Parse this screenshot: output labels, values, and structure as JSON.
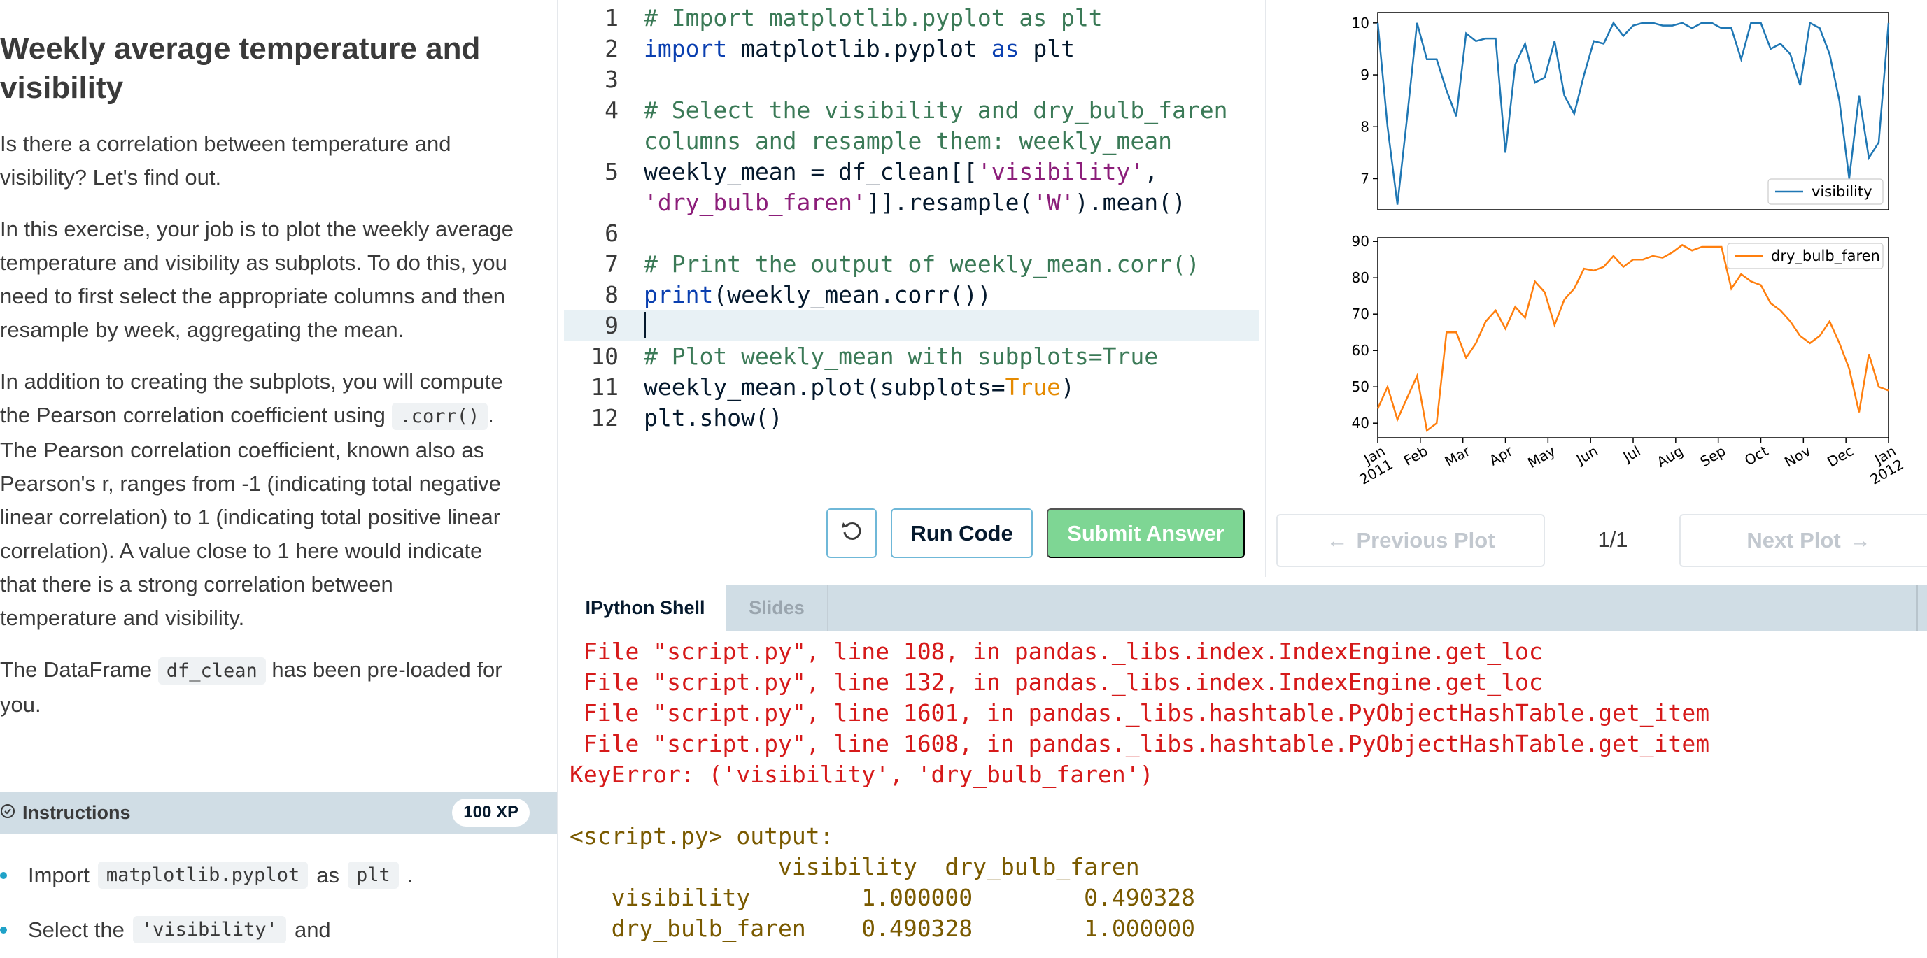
{
  "exercise": {
    "title_line1": "Weekly average temperature and",
    "title_line2": "visibility",
    "p1_line1": "Is there a correlation between temperature and",
    "p1_line2": "visibility? Let's find out.",
    "p2_line1": "In this exercise, your job is to plot the weekly average",
    "p2_line2": "temperature and visibility as subplots. To do this, you",
    "p2_line3": "need to first select the appropriate columns and then",
    "p2_line4": "resample by week, aggregating the mean.",
    "p3_line1": "In addition to creating the subplots, you will compute",
    "p3_line2_pre": "the Pearson correlation coefficient using",
    "p3_code": ".corr()",
    "p3_line2_post": ".",
    "p3_line3": "The Pearson correlation coefficient, known also as",
    "p3_line4": "Pearson's r, ranges from -1 (indicating total negative",
    "p3_line5": "linear correlation) to 1 (indicating total positive linear",
    "p3_line6": "correlation). A value close to 1 here would indicate",
    "p3_line7": "that there is a strong correlation between",
    "p3_line8": "temperature and visibility.",
    "p4_pre": "The DataFrame",
    "p4_code": "df_clean",
    "p4_post": "has been pre-loaded for",
    "p4_line2": "you."
  },
  "instructions": {
    "label": "Instructions",
    "xp": "100 XP",
    "item1_pre": "Import",
    "item1_code1": "matplotlib.pyplot",
    "item1_mid": "as",
    "item1_code2": "plt",
    "item1_post": ".",
    "item2_pre": "Select the",
    "item2_code": "'visibility'",
    "item2_post": "and"
  },
  "editor": {
    "lines": [
      {
        "n": "1",
        "tokens": [
          {
            "t": "# Import matplotlib.pyplot as plt",
            "c": "comment"
          }
        ]
      },
      {
        "n": "2",
        "tokens": [
          {
            "t": "import",
            "c": "kw"
          },
          {
            "t": " matplotlib.pyplot ",
            "c": "plain"
          },
          {
            "t": "as",
            "c": "kw"
          },
          {
            "t": " plt",
            "c": "plain"
          }
        ]
      },
      {
        "n": "3",
        "tokens": []
      },
      {
        "n": "4",
        "tokens": [
          {
            "t": "# Select the visibility and dry_bulb_faren",
            "c": "comment"
          }
        ]
      },
      {
        "n": "",
        "tokens": [
          {
            "t": "columns and resample them: weekly_mean",
            "c": "comment"
          }
        ]
      },
      {
        "n": "5",
        "tokens": [
          {
            "t": "weekly_mean = df_clean[[",
            "c": "plain"
          },
          {
            "t": "'visibility'",
            "c": "str"
          },
          {
            "t": ",",
            "c": "plain"
          }
        ]
      },
      {
        "n": "",
        "tokens": [
          {
            "t": "'dry_bulb_faren'",
            "c": "str"
          },
          {
            "t": "]].resample(",
            "c": "plain"
          },
          {
            "t": "'W'",
            "c": "str"
          },
          {
            "t": ").mean()",
            "c": "plain"
          }
        ]
      },
      {
        "n": "6",
        "tokens": []
      },
      {
        "n": "7",
        "tokens": [
          {
            "t": "# Print the output of weekly_mean.corr()",
            "c": "comment"
          }
        ]
      },
      {
        "n": "8",
        "tokens": [
          {
            "t": "print",
            "c": "kw"
          },
          {
            "t": "(weekly_mean.corr())",
            "c": "plain"
          }
        ]
      },
      {
        "n": "9",
        "tokens": [],
        "active": true
      },
      {
        "n": "10",
        "tokens": [
          {
            "t": "# Plot weekly_mean with subplots=True",
            "c": "comment"
          }
        ]
      },
      {
        "n": "11",
        "tokens": [
          {
            "t": "weekly_mean.plot(subplots=",
            "c": "plain"
          },
          {
            "t": "True",
            "c": "bool"
          },
          {
            "t": ")",
            "c": "plain"
          }
        ]
      },
      {
        "n": "12",
        "tokens": [
          {
            "t": "plt.show()",
            "c": "plain"
          }
        ]
      }
    ],
    "run_label": "Run Code",
    "submit_label": "Submit Answer"
  },
  "plot_nav": {
    "prev_label": "Previous Plot",
    "next_label": "Next Plot",
    "counter": "1/1"
  },
  "shell": {
    "tab_shell": "IPython Shell",
    "tab_slides": "Slides",
    "lines": [
      {
        "t": " File \"script.py\", line 108, in pandas._libs.index.IndexEngine.get_loc",
        "c": "err"
      },
      {
        "t": " File \"script.py\", line 132, in pandas._libs.index.IndexEngine.get_loc",
        "c": "err"
      },
      {
        "t": " File \"script.py\", line 1601, in pandas._libs.hashtable.PyObjectHashTable.get_item",
        "c": "err"
      },
      {
        "t": " File \"script.py\", line 1608, in pandas._libs.hashtable.PyObjectHashTable.get_item",
        "c": "err"
      },
      {
        "t": "KeyError: ('visibility', 'dry_bulb_faren')",
        "c": "err"
      },
      {
        "t": "",
        "c": "plain"
      },
      {
        "t": "<script.py> output:",
        "c": "out"
      },
      {
        "t": "               visibility  dry_bulb_faren",
        "c": "out"
      },
      {
        "t": "   visibility        1.000000        0.490328",
        "c": "out"
      },
      {
        "t": "   dry_bulb_faren    0.490328        1.000000",
        "c": "out"
      }
    ]
  },
  "chart_data": [
    {
      "type": "line",
      "series": [
        {
          "name": "visibility",
          "color": "#1f77b4",
          "values": [
            10.0,
            8.0,
            6.5,
            8.2,
            10.0,
            9.3,
            9.3,
            8.7,
            8.2,
            9.8,
            9.65,
            9.7,
            9.7,
            7.5,
            9.2,
            9.6,
            8.85,
            8.95,
            9.65,
            8.6,
            8.25,
            9.0,
            9.65,
            9.6,
            10.0,
            9.75,
            9.95,
            10.0,
            10.0,
            9.95,
            9.95,
            10.0,
            9.9,
            10.0,
            10.0,
            9.9,
            9.9,
            9.3,
            10.0,
            10.0,
            9.5,
            9.6,
            9.4,
            8.8,
            10.0,
            9.9,
            9.4,
            8.5,
            7.0,
            8.6,
            7.4,
            7.7,
            10.0
          ]
        }
      ],
      "ylim": [
        6.4,
        10.2
      ],
      "yticks": [
        "7",
        "8",
        "9",
        "10"
      ],
      "legend": "bottom-right"
    },
    {
      "type": "line",
      "series": [
        {
          "name": "dry_bulb_faren",
          "color": "#ff7f0e",
          "values": [
            44,
            50,
            41,
            47,
            53,
            38,
            40,
            65,
            65,
            58,
            62,
            68,
            71,
            66,
            72,
            69,
            79,
            76,
            67,
            74,
            77,
            82.5,
            82,
            83,
            86,
            83,
            85,
            85,
            86,
            85.5,
            87,
            89,
            87.5,
            88.5,
            88.5,
            88.5,
            77,
            81,
            79,
            78,
            73,
            71,
            68,
            64,
            62,
            64,
            68,
            62,
            55,
            43,
            59,
            50,
            49
          ]
        }
      ],
      "ylim": [
        36,
        91
      ],
      "yticks": [
        "40",
        "50",
        "60",
        "70",
        "80",
        "90"
      ],
      "legend": "top-right",
      "xtick_labels": [
        "Jan\n2011",
        "Feb",
        "Mar",
        "Apr",
        "May",
        "Jun",
        "Jul",
        "Aug",
        "Sep",
        "Oct",
        "Nov",
        "Dec",
        "Jan\n2012"
      ]
    }
  ]
}
